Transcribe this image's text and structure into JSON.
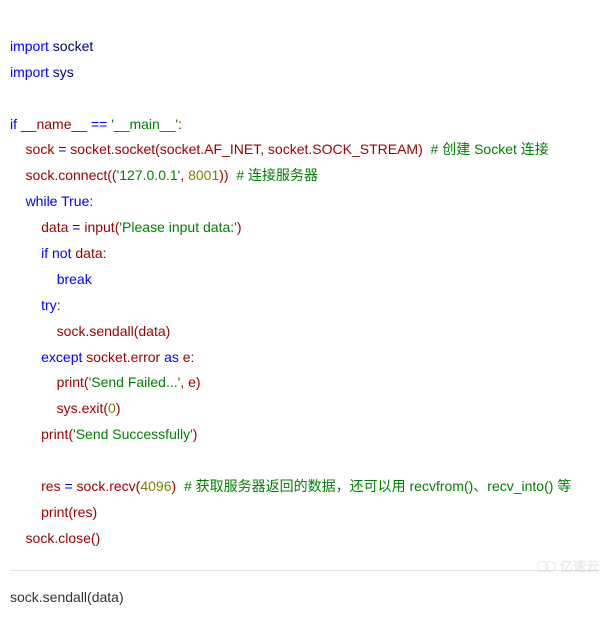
{
  "code": {
    "l1": {
      "a": "import",
      "b": " socket"
    },
    "l2": {
      "a": "import",
      "b": " sys"
    },
    "l3": {
      "a": "if",
      "b": " __name__ ",
      "c": "==",
      "d": " '__main__'",
      "e": ":"
    },
    "l4": {
      "a": "    sock ",
      "b": "=",
      "c": " socket.socket(socket.AF_INET, socket.SOCK_STREAM)  ",
      "d": "# 创建 Socket 连接"
    },
    "l5": {
      "a": "    sock.connect((",
      "b": "'127.0.0.1'",
      "c": ", ",
      "d": "8001",
      "e": "))  ",
      "f": "# 连接服务器"
    },
    "l6": {
      "a": "    ",
      "b": "while",
      "c": " ",
      "d": "True",
      "e": ":"
    },
    "l7": {
      "a": "        data ",
      "b": "=",
      "c": " input(",
      "d": "'Please input data:'",
      "e": ")"
    },
    "l8": {
      "a": "        ",
      "b": "if",
      "c": " ",
      "d": "not",
      "e": " data:"
    },
    "l9": {
      "a": "            ",
      "b": "break"
    },
    "l10": {
      "a": "        ",
      "b": "try",
      "c": ":"
    },
    "l11": {
      "a": "            sock.sendall(data)"
    },
    "l12": {
      "a": "        ",
      "b": "except",
      "c": " socket.error ",
      "d": "as",
      "e": " e:"
    },
    "l13": {
      "a": "            print(",
      "b": "'Send Failed...'",
      "c": ", e)"
    },
    "l14": {
      "a": "            sys.exit(",
      "b": "0",
      "c": ")"
    },
    "l15": {
      "a": "        print(",
      "b": "'Send Successfully'",
      "c": ")"
    },
    "l16": {
      "a": "        res ",
      "b": "=",
      "c": " sock.recv(",
      "d": "4096",
      "e": ")  ",
      "f": "# 获取服务器返回的数据，还可以用 recvfrom()、recv_into() 等"
    },
    "l17": {
      "a": "        print(res)"
    },
    "l18": {
      "a": "    sock.close()"
    }
  },
  "footer": "sock.sendall(data)",
  "watermark": "亿速云"
}
